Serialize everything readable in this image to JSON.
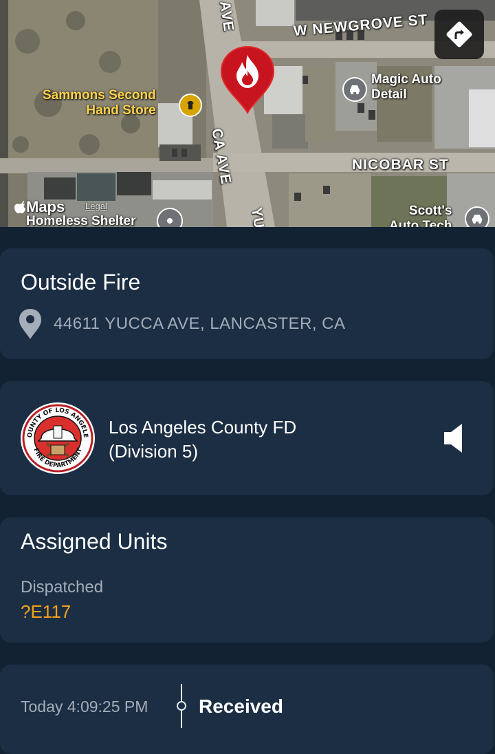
{
  "map": {
    "streets": {
      "w_newgrove": "W NEWGROVE ST",
      "nicobar": "NICOBAR ST",
      "yucca_main": "CA AVE",
      "yucca_top": "AVE",
      "yucca_bottom": "YU"
    },
    "pois": {
      "sammons": "Sammons Second\nHand Store",
      "magic_auto": "Magic Auto\nDetail",
      "scotts": "Scott's\nAuto Tech",
      "homeless": "Homeless Shelter"
    },
    "attribution": "Maps",
    "legal": "Legal",
    "pin_icon": "fire-icon",
    "directions_icon": "directions-icon"
  },
  "incident": {
    "title": "Outside Fire",
    "address": "44611 YUCCA AVE, LANCASTER, CA",
    "location_icon": "location-pin-icon"
  },
  "agency": {
    "name_line1": "Los Angeles County FD",
    "name_line2": "(Division 5)",
    "logo_text_top": "COUNTY OF LOS ANGELES",
    "logo_text_bottom": "FIRE DEPARTMENT",
    "audio_icon": "speaker-icon"
  },
  "units": {
    "title": "Assigned Units",
    "status": "Dispatched",
    "unit": "?E117"
  },
  "timeline": {
    "time": "Today 4:09:25 PM",
    "event": "Received"
  },
  "colors": {
    "background": "#132233",
    "card": "#1b2e44",
    "accent_orange": "#f4a01b",
    "pin_red": "#c8141e",
    "muted_text": "#a4adb8"
  }
}
